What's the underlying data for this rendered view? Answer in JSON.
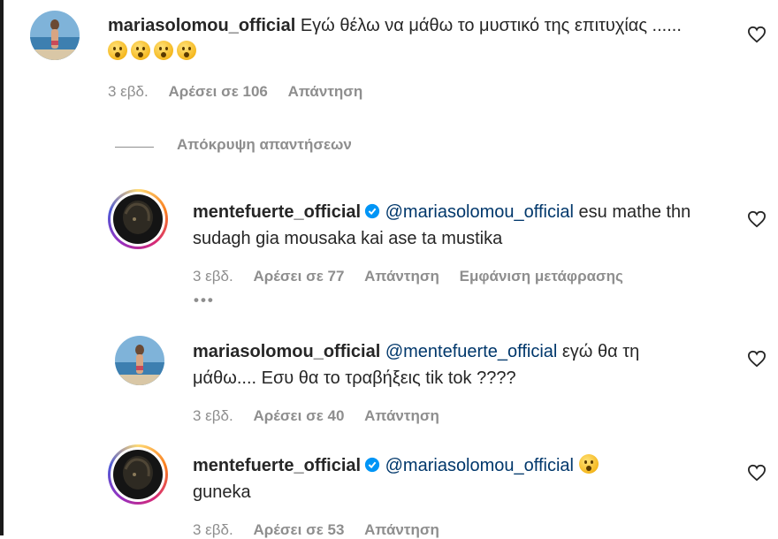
{
  "comments": [
    {
      "username": "mariasolomou_official",
      "text": "Εγώ θέλω να μάθω το μυστικό της επιτυχίας ......",
      "time": "3 εβδ.",
      "likes": "Αρέσει σε 106",
      "reply": "Απάντηση"
    },
    {
      "username": "mentefuerte_official",
      "mention": "@mariasolomou_official",
      "text": "esu mathe thn sudagh gia mousaka kai ase ta mustika",
      "time": "3 εβδ.",
      "likes": "Αρέσει σε 77",
      "reply": "Απάντηση",
      "translate": "Εμφάνιση μετάφρασης",
      "more": "•••"
    },
    {
      "username": "mariasolomou_official",
      "mention": "@mentefuerte_official",
      "text": "εγώ θα τη μάθω.... Εσυ θα το τραβήξεις tik tok ????",
      "time": "3 εβδ.",
      "likes": "Αρέσει σε 40",
      "reply": "Απάντηση"
    },
    {
      "username": "mentefuerte_official",
      "mention": "@mariasolomou_official",
      "text": "guneka",
      "time": "3 εβδ.",
      "likes": "Αρέσει σε 53",
      "reply": "Απάντηση"
    }
  ],
  "hide_replies": "Απόκρυψη απαντήσεων",
  "colors": {
    "mention": "#00376b",
    "meta": "#8e8e8e",
    "verified": "#0095f6"
  },
  "icons": [
    "heart-icon",
    "verified-badge-icon",
    "astonished-emoji-icon"
  ]
}
